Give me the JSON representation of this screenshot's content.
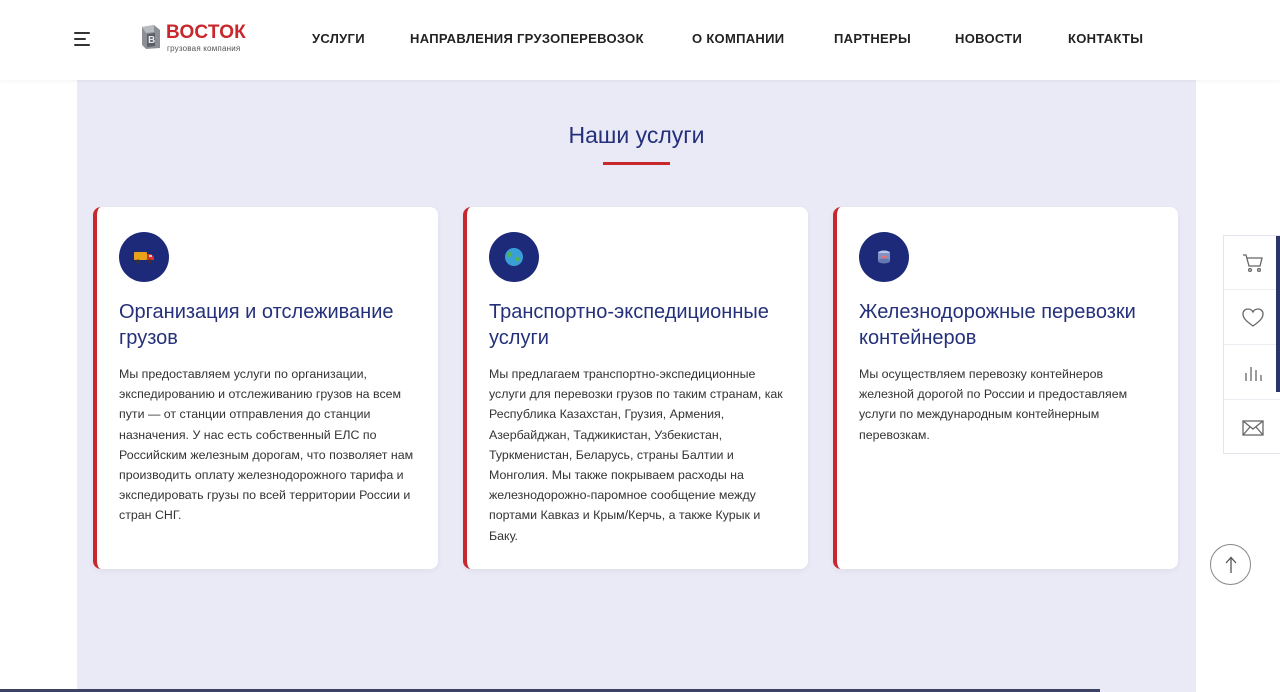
{
  "header": {
    "logo_name": "ВОСТОК",
    "logo_sub": "грузовая компания",
    "nav": [
      {
        "label": "УСЛУГИ"
      },
      {
        "label": "НАПРАВЛЕНИЯ ГРУЗОПЕРЕВОЗОК"
      },
      {
        "label": "О КОМПАНИИ"
      },
      {
        "label": "ПАРТНЕРЫ"
      },
      {
        "label": "НОВОСТИ"
      },
      {
        "label": "КОНТАКТЫ"
      }
    ]
  },
  "services": {
    "title": "Наши услуги",
    "cards": [
      {
        "icon": "truck-icon",
        "title": "Организация и отслеживание грузов",
        "text": "Мы предоставляем услуги по организации, экспедированию и отслеживанию грузов на всем пути — от станции отправления до станции назначения. У нас есть собственный ЕЛС по Российским железным дорогам, что позволяет нам производить оплату железнодорожного тарифа и экспедировать грузы по всей территории России и стран СНГ."
      },
      {
        "icon": "globe-icon",
        "title": "Транспортно-экспедиционные услуги",
        "text": "Мы предлагаем транспортно-экспедиционные услуги для перевозки грузов по таким странам, как Республика Казахстан, Грузия, Армения, Азербайджан, Таджикистан, Узбекистан, Туркменистан, Беларусь, страны Балтии и Монголия. Мы также покрываем расходы на железнодорожно-паромное сообщение между портами Кавказ и Крым/Керчь, а также Курык и Баку."
      },
      {
        "icon": "container-icon",
        "title": "Железнодорожные перевозки контейнеров",
        "text": "Мы осуществляем перевозку контейнеров железной дорогой по России и предоставляем услуги по международным контейнерным перевозкам."
      }
    ]
  },
  "side_tools": [
    "cart-icon",
    "heart-icon",
    "compare-icon",
    "mail-icon"
  ],
  "colors": {
    "accent": "#c8272c",
    "brand_blue": "#24307a",
    "section_bg": "#eaeaf6",
    "icon_bg": "#1d2a7a"
  }
}
